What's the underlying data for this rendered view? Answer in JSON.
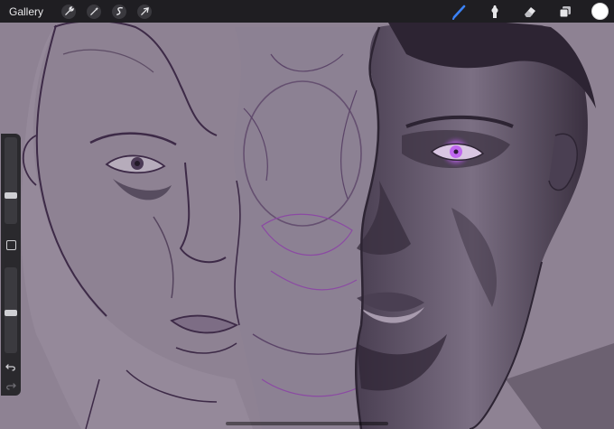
{
  "app": {
    "gallery_label": "Gallery"
  },
  "toolbar": {
    "left_tools": [
      {
        "icon": "wrench-icon",
        "name": "actions"
      },
      {
        "icon": "magic-wand-icon",
        "name": "adjustments"
      },
      {
        "icon": "selection-s-icon",
        "name": "selection"
      },
      {
        "icon": "arrow-cursor-icon",
        "name": "transform"
      }
    ],
    "right_tools": [
      {
        "icon": "brush-icon",
        "name": "brush",
        "active": true
      },
      {
        "icon": "smudge-icon",
        "name": "smudge"
      },
      {
        "icon": "eraser-icon",
        "name": "eraser"
      },
      {
        "icon": "layers-icon",
        "name": "layers"
      }
    ],
    "active_color": "#ffffff",
    "active_tool_color": "#3b82f6"
  },
  "sidebar": {
    "brush_size_level": 0.45,
    "opacity_level": 0.5
  },
  "artwork": {
    "palette": {
      "background": "#8a7f91",
      "line": "#3d2a47",
      "shadow": "#2d2433",
      "eye": "#c067f0"
    }
  }
}
